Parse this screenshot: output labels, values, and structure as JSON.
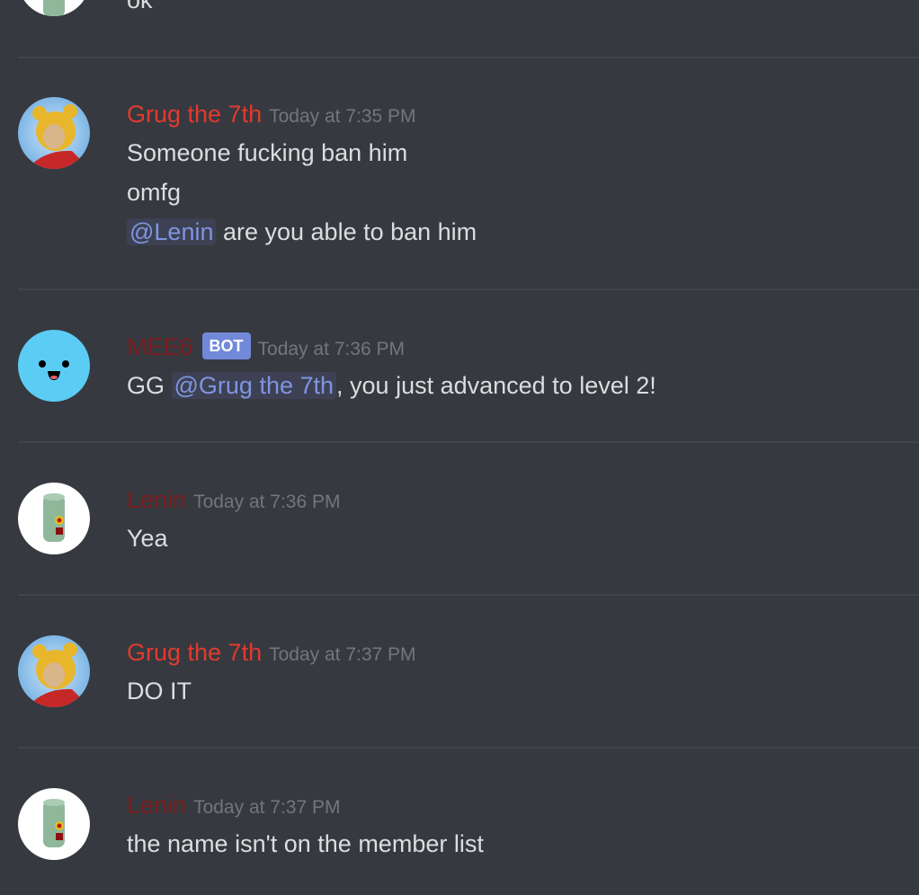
{
  "colors": {
    "background": "#36393f",
    "grug": "#e03b2f",
    "lenin": "#7a1c1c",
    "mee6": "#7a1c1c",
    "mention": "#7f95e0",
    "bot_badge": "#7289da",
    "timestamp": "#72767d"
  },
  "messages": [
    {
      "author": "",
      "timestamp": "",
      "avatar": "lenin-avatar",
      "lines": [
        "ok"
      ]
    },
    {
      "author": "Grug the 7th",
      "timestamp": "Today at 7:35 PM",
      "avatar": "winnie-avatar",
      "lines": [
        "Someone fucking ban him",
        "omfg"
      ],
      "mention_line": {
        "mention": "@Lenin",
        "text": " are you able to ban him"
      }
    },
    {
      "author": "MEE6",
      "badge": "BOT",
      "timestamp": "Today at 7:36 PM",
      "avatar": "mee6-avatar",
      "prefix": "GG ",
      "mention": "@Grug the 7th",
      "suffix": ", you just advanced to level 2!"
    },
    {
      "author": "Lenin",
      "timestamp": "Today at 7:36 PM",
      "avatar": "lenin-avatar",
      "lines": [
        "Yea"
      ]
    },
    {
      "author": "Grug the 7th",
      "timestamp": "Today at 7:37 PM",
      "avatar": "winnie-avatar",
      "lines": [
        "DO IT"
      ]
    },
    {
      "author": "Lenin",
      "timestamp": "Today at 7:37 PM",
      "avatar": "lenin-avatar",
      "lines": [
        "the name isn't on the member list"
      ]
    }
  ]
}
